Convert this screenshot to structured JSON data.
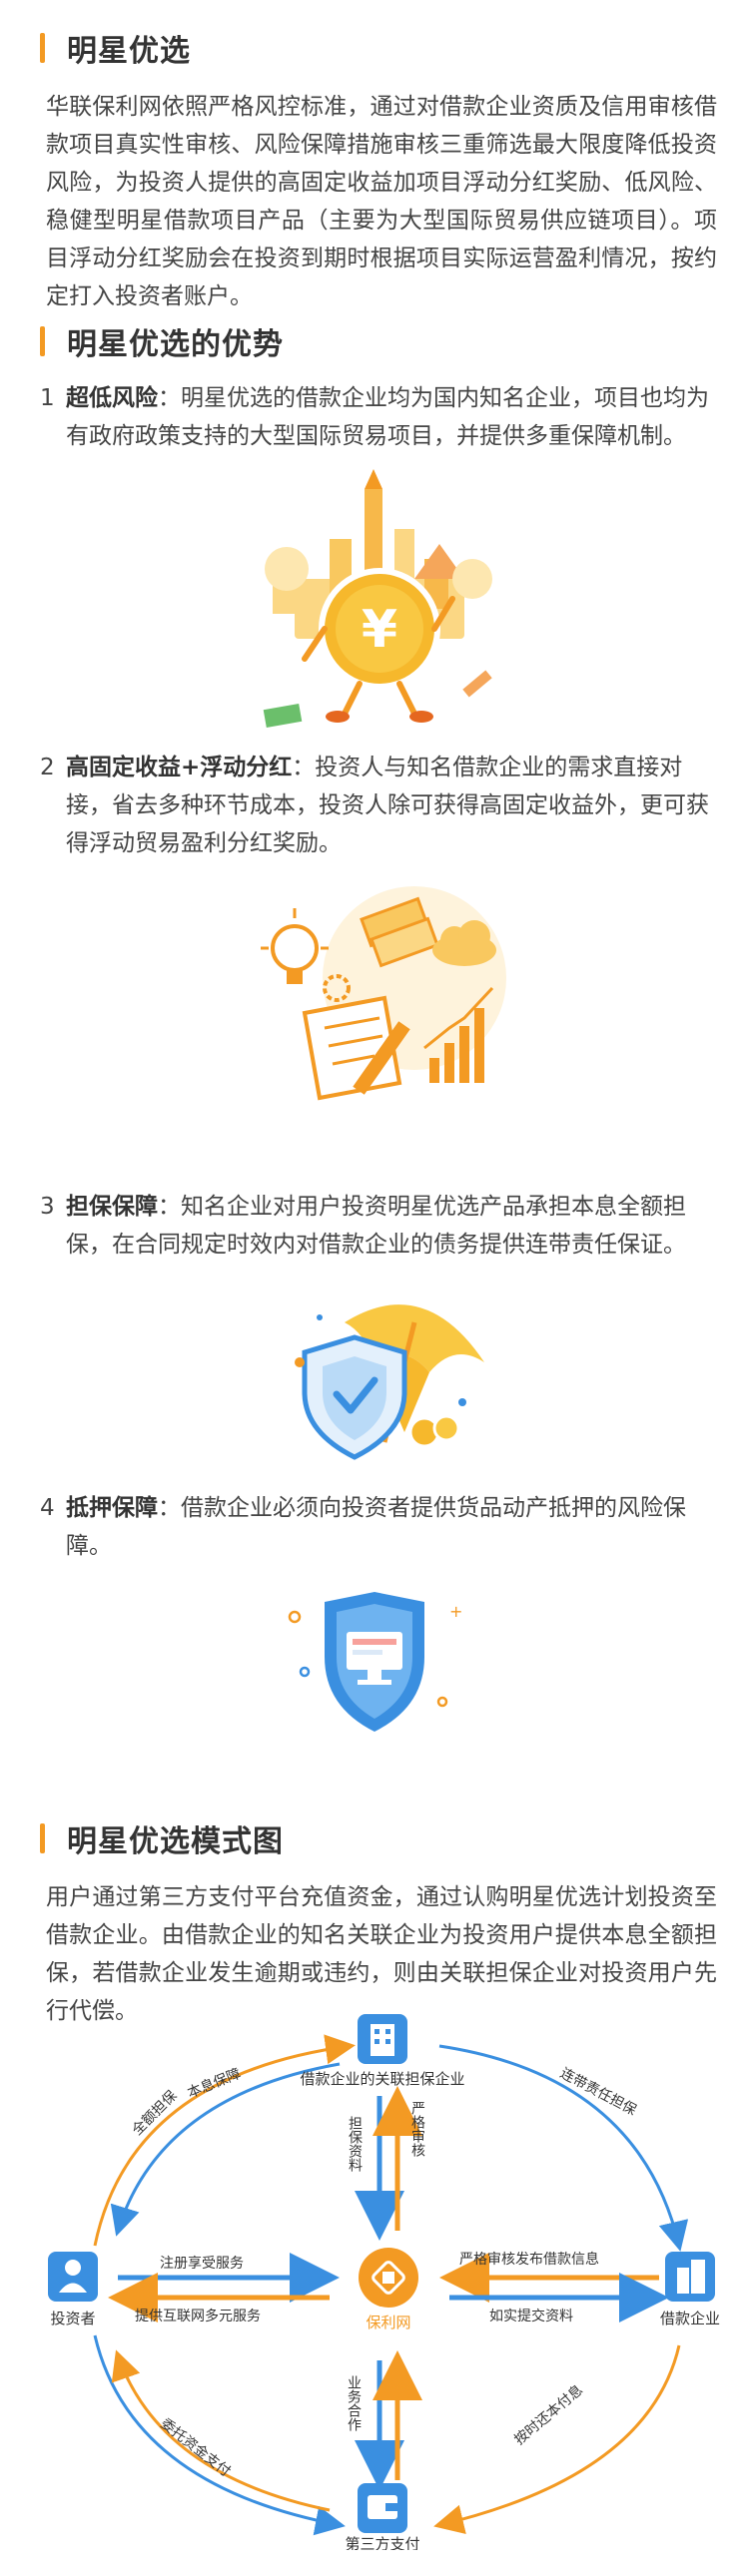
{
  "sections": [
    {
      "title": "明星优选",
      "paragraph": "华联保利网依照严格风控标准，通过对借款企业资质及信用审核借款项目真实性审核、风险保障措施审核三重筛选最大限度降低投资风险，为投资人提供的高固定收益加项目浮动分红奖励、低风险、稳健型明星借款项目产品（主要为大型国际贸易供应链项目）。项目浮动分红奖励会在投资到期时根据项目实际运营盈利情况，按约定打入投资者账户。"
    },
    {
      "title": "明星优选的优势",
      "items": [
        {
          "num": "1",
          "title": "超低风险",
          "text": "：明星优选的借款企业均为国内知名企业，项目也均为有政府政策支持的大型国际贸易项目，并提供多重保障机制。",
          "illustration": "coin-city-icon"
        },
        {
          "num": "2",
          "title": "高固定收益+浮动分红",
          "text": "：投资人与知名借款企业的需求直接对接，省去多种环节成本，投资人除可获得高固定收益外，更可获得浮动贸易盈利分红奖励。",
          "illustration": "lightbulb-chart-icon"
        },
        {
          "num": "3",
          "title": "担保保障",
          "text": "：知名企业对用户投资明星优选产品承担本息全额担保，在合同规定时效内对借款企业的债务提供连带责任保证。",
          "illustration": "umbrella-shield-icon"
        },
        {
          "num": "4",
          "title": "抵押保障",
          "text": "：借款企业必须向投资者提供货品动产抵押的风险保障。",
          "illustration": "monitor-shield-icon"
        }
      ]
    },
    {
      "title": "明星优选模式图",
      "paragraph": "用户通过第三方支付平台充值资金，通过认购明星优选计划投资至借款企业。由借款企业的知名关联企业为投资用户提供本息全额担保，若借款企业发生逾期或违约，则由关联担保企业对投资用户先行代偿。"
    }
  ],
  "diagram": {
    "nodes": {
      "top": "借款企业的关联担保企业",
      "left": "投资者",
      "center": "保利网",
      "right": "借款企业",
      "bottom": "第三方支付"
    },
    "labels": {
      "full_guarantee": "全额担保",
      "principal_interest": "本息保障",
      "joint_liability": "连带责任担保",
      "guarantee_info": "担保资料",
      "strict_review": "严格审核",
      "register": "注册享受服务",
      "provide_service": "提供互联网多元服务",
      "review_publish": "严格审核发布借款信息",
      "submit_info": "如实提交资料",
      "business": "业务合作",
      "repay": "按时还本付息",
      "entrust": "委托资金支付"
    },
    "colors": {
      "orange": "#f39a23",
      "blue": "#3a8fe0",
      "text": "#333333"
    }
  }
}
